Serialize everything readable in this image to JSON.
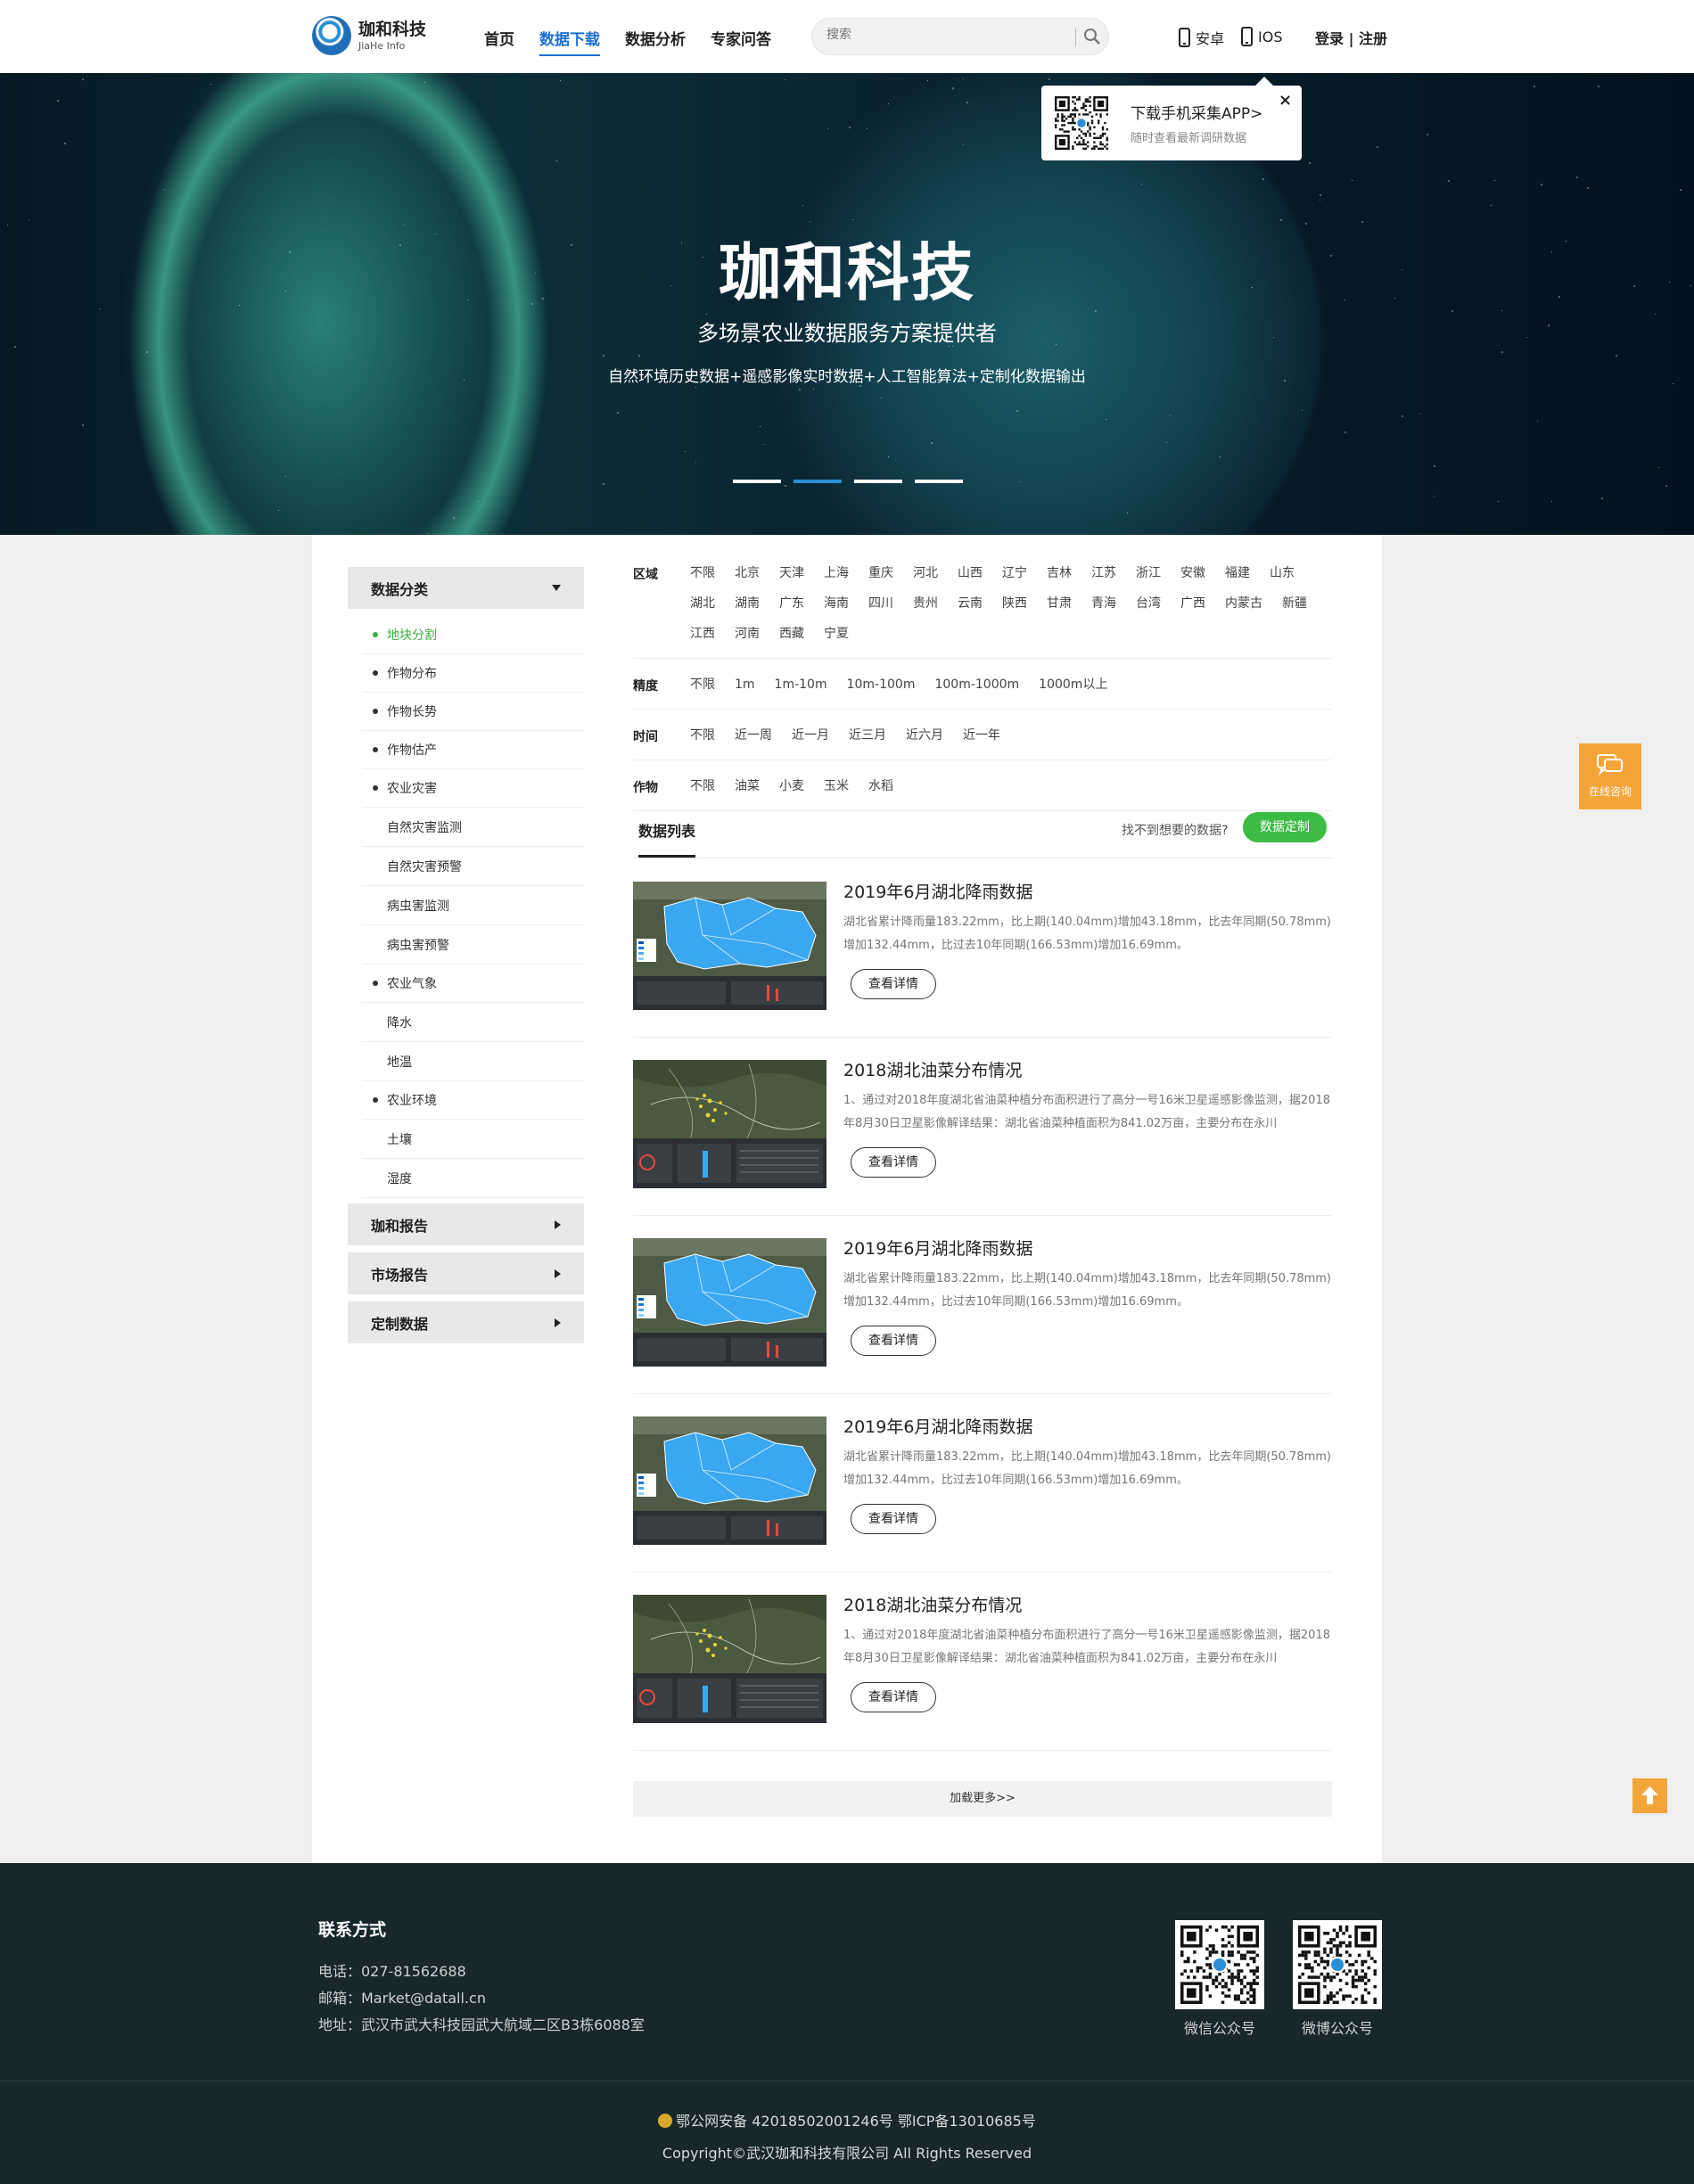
{
  "header": {
    "logo_cn": "珈和科技",
    "logo_en": "JiaHe Info",
    "nav": [
      "首页",
      "数据下载",
      "数据分析",
      "专家问答"
    ],
    "search_placeholder": "搜索",
    "android": "安卓",
    "ios": "IOS",
    "login": "登录 | 注册"
  },
  "popup": {
    "title": "下载手机采集APP>",
    "subtitle": "随时查看最新调研数据",
    "close": "×"
  },
  "banner": {
    "title": "珈和科技",
    "subtitle": "多场景农业数据服务方案提供者",
    "desc": "自然环境历史数据+遥感影像实时数据+人工智能算法+定制化数据输出"
  },
  "sidebar": {
    "category": "数据分类",
    "items": [
      {
        "label": "地块分割",
        "level": 1,
        "active": true
      },
      {
        "label": "作物分布",
        "level": 1
      },
      {
        "label": "作物长势",
        "level": 1
      },
      {
        "label": "作物估产",
        "level": 1
      },
      {
        "label": "农业灾害",
        "level": 1
      },
      {
        "label": "自然灾害监测",
        "level": 2
      },
      {
        "label": "自然灾害预警",
        "level": 2
      },
      {
        "label": "病虫害监测",
        "level": 2
      },
      {
        "label": "病虫害预警",
        "level": 2
      },
      {
        "label": "农业气象",
        "level": 1
      },
      {
        "label": "降水",
        "level": 2
      },
      {
        "label": "地温",
        "level": 2
      },
      {
        "label": "农业环境",
        "level": 1
      },
      {
        "label": "土壤",
        "level": 2
      },
      {
        "label": "湿度",
        "level": 2
      }
    ],
    "groups": [
      "珈和报告",
      "市场报告",
      "定制数据"
    ]
  },
  "filters": [
    {
      "label": "区域",
      "options": [
        "不限",
        "北京",
        "天津",
        "上海",
        "重庆",
        "河北",
        "山西",
        "辽宁",
        "吉林",
        "江苏",
        "浙江",
        "安徽",
        "福建",
        "山东",
        "湖北",
        "湖南",
        "广东",
        "海南",
        "四川",
        "贵州",
        "云南",
        "陕西",
        "甘肃",
        "青海",
        "台湾",
        "广西",
        "内蒙古",
        "新疆",
        "江西",
        "河南",
        "西藏",
        "宁夏"
      ]
    },
    {
      "label": "精度",
      "options": [
        "不限",
        "1m",
        "1m-10m",
        "10m-100m",
        "100m-1000m",
        "1000m以上"
      ]
    },
    {
      "label": "时间",
      "options": [
        "不限",
        "近一周",
        "近一月",
        "近三月",
        "近六月",
        "近一年"
      ]
    },
    {
      "label": "作物",
      "options": [
        "不限",
        "油菜",
        "小麦",
        "玉米",
        "水稻"
      ]
    }
  ],
  "list": {
    "title": "数据列表",
    "hint": "找不到想要的数据?",
    "custom_button": "数据定制",
    "detail_label": "查看详情",
    "load_more": "加载更多>>",
    "items": [
      {
        "title": "2019年6月湖北降雨数据",
        "desc": "湖北省累计降雨量183.22mm，比上期(140.04mm)增加43.18mm，比去年同期(50.78mm)增加132.44mm，比过去10年同期(166.53mm)增加16.69mm。",
        "thumb": "rain"
      },
      {
        "title": "2018湖北油菜分布情况",
        "desc": "1、通过对2018年度湖北省油菜种植分布面积进行了高分一号16米卫星遥感影像监测，据2018年8月30日卫星影像解译结果：湖北省油菜种植面积为841.02万亩，主要分布在永川",
        "thumb": "rape"
      },
      {
        "title": "2019年6月湖北降雨数据",
        "desc": "湖北省累计降雨量183.22mm，比上期(140.04mm)增加43.18mm，比去年同期(50.78mm)增加132.44mm，比过去10年同期(166.53mm)增加16.69mm。",
        "thumb": "rain"
      },
      {
        "title": "2019年6月湖北降雨数据",
        "desc": "湖北省累计降雨量183.22mm，比上期(140.04mm)增加43.18mm，比去年同期(50.78mm)增加132.44mm，比过去10年同期(166.53mm)增加16.69mm。",
        "thumb": "rain"
      },
      {
        "title": "2018湖北油菜分布情况",
        "desc": "1、通过对2018年度湖北省油菜种植分布面积进行了高分一号16米卫星遥感影像监测，据2018年8月30日卫星影像解译结果：湖北省油菜种植面积为841.02万亩，主要分布在永川",
        "thumb": "rape"
      }
    ]
  },
  "float": {
    "consult": "在线咨询"
  },
  "footer": {
    "contact_title": "联系方式",
    "phone": "电话：027-81562688",
    "email": "邮箱：Market@datall.cn",
    "address": "地址：武汉市武大科技园武大航域二区B3栋6088室",
    "qr_wechat": "微信公众号",
    "qr_weibo": "微博公众号",
    "beian": "鄂公网安备 42018502001246号    鄂ICP备13010685号",
    "copyright": "Copyright©武汉珈和科技有限公司 All Rights Reserved"
  },
  "colors": {
    "accent": "#1c6fd1",
    "green": "#3cbb45",
    "orange": "#f4a53a",
    "footer": "#17272c"
  }
}
